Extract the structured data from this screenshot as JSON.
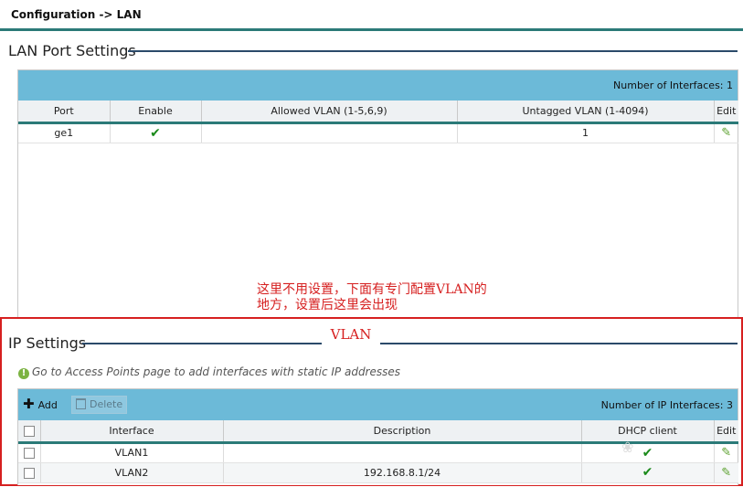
{
  "breadcrumb": "Configuration -> LAN",
  "lan_section": {
    "title": "LAN Port Settings",
    "count_label": "Number of Interfaces:",
    "count_value": "1",
    "columns": [
      "Port",
      "Enable",
      "Allowed VLAN (1-5,6,9)",
      "Untagged VLAN (1-4094)",
      "Edit"
    ],
    "rows": [
      {
        "port": "ge1",
        "enabled": true,
        "allowed_vlan": "",
        "untagged_vlan": "1"
      }
    ]
  },
  "annotation": {
    "line1": "这里不用设置，下面有专门配置VLAN的",
    "line2": "地方，设置后这里会出现",
    "vlan_label": "VLAN"
  },
  "ip_section": {
    "title": "IP Settings",
    "info_text": "Go to Access Points page to add interfaces with static IP addresses",
    "add_label": "Add",
    "delete_label": "Delete",
    "count_label": "Number of IP Interfaces:",
    "count_value": "3",
    "columns": [
      "Interface",
      "Description",
      "DHCP client",
      "Edit"
    ],
    "rows": [
      {
        "interface": "VLAN1",
        "description": "",
        "dhcp_client": true
      },
      {
        "interface": "VLAN2",
        "description": "192.168.8.1/24",
        "dhcp_client": true
      }
    ]
  },
  "icons": {
    "check": "check-icon",
    "edit": "pencil-icon",
    "add": "plus-icon",
    "delete": "trash-icon",
    "info": "info-icon"
  },
  "colors": {
    "header_bar": "#6cbad8",
    "accent_line": "#2b7a78",
    "annotation_red": "#d62020",
    "check_green": "#1a8a1a"
  }
}
